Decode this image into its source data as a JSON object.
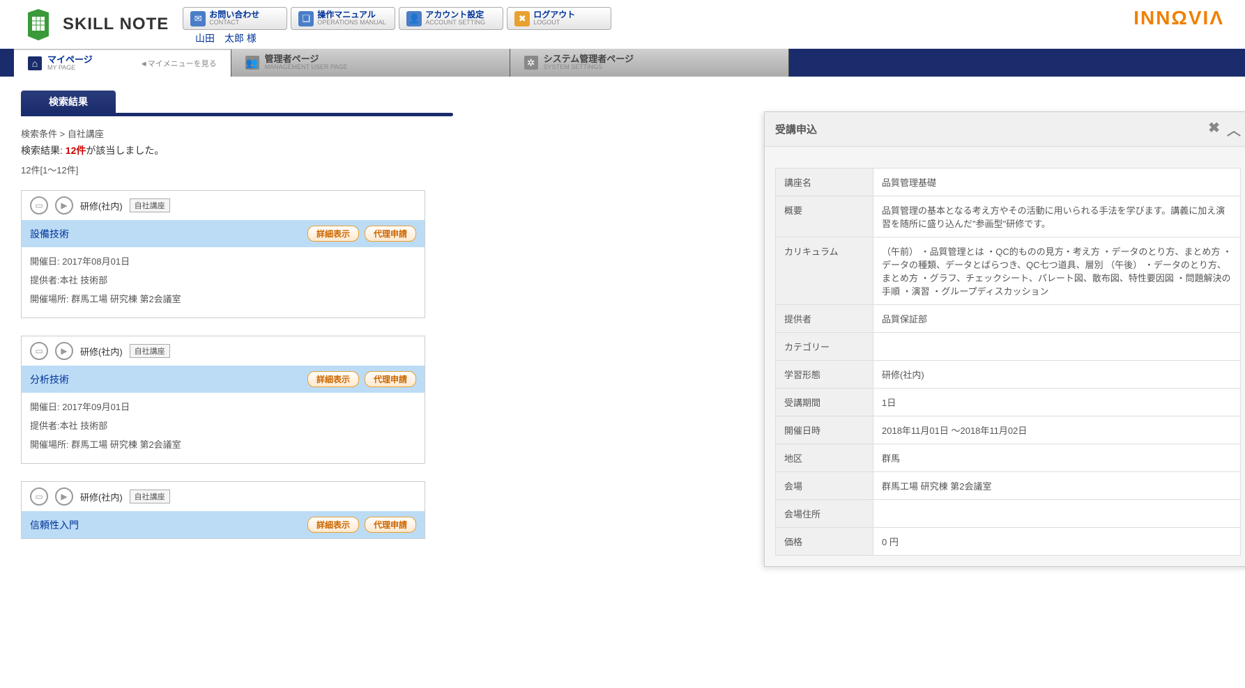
{
  "logo_text": "SKILL NOTE",
  "username": "山田　太郎 様",
  "header_buttons": [
    {
      "jp": "お問い合わせ",
      "en": "CONTACT",
      "icon": "✉",
      "color": "blue"
    },
    {
      "jp": "操作マニュアル",
      "en": "OPERATIONS MANUAL",
      "icon": "❏",
      "color": "blue"
    },
    {
      "jp": "アカウント設定",
      "en": "ACCOUNT SETTING",
      "icon": "👤",
      "color": "blue"
    },
    {
      "jp": "ログアウト",
      "en": "LOGOUT",
      "icon": "✖",
      "color": "orange"
    }
  ],
  "brand_right": "INNΩVIΛ",
  "nav_tabs": [
    {
      "jp": "マイページ",
      "en": "MY PAGE",
      "icon": "⌂",
      "active": true,
      "submenu": "◄マイメニューを見る"
    },
    {
      "jp": "管理者ページ",
      "en": "MANAGEMENT USER PAGE",
      "icon": "👥",
      "active": false
    },
    {
      "jp": "システム管理者ページ",
      "en": "SYSTEM SETTINGS",
      "icon": "✲",
      "active": false
    }
  ],
  "section_title": "検索結果",
  "breadcrumb": "検索条件 > 自社講座",
  "result_prefix": "検索結果: ",
  "result_count": "12件",
  "result_suffix": "が該当しました。",
  "pager_info": "12件[1～12件]",
  "card_labels": {
    "type": "研修(社内)",
    "badge": "自社講座",
    "detail_btn": "詳細表示",
    "proxy_btn": "代理申請",
    "date_label": "開催日: ",
    "provider_label": "提供者:",
    "venue_label": "開催場所: "
  },
  "results": [
    {
      "title": "設備技術",
      "date": "2017年08月01日",
      "provider": "本社  技術部",
      "venue": "群馬工場  研究棟  第2会議室"
    },
    {
      "title": "分析技術",
      "date": "2017年09月01日",
      "provider": "本社  技術部",
      "venue": "群馬工場  研究棟  第2会議室"
    },
    {
      "title": "信頼性入門",
      "date": "",
      "provider": "",
      "venue": ""
    }
  ],
  "panel": {
    "title": "受講申込",
    "fields": [
      {
        "label": "講座名",
        "value": "品質管理基礎"
      },
      {
        "label": "概要",
        "value": "品質管理の基本となる考え方やその活動に用いられる手法を学びます。講義に加え演習を随所に盛り込んだ\"参画型\"研修です。"
      },
      {
        "label": "カリキュラム",
        "value": "（午前） ・品質管理とは ・QC的ものの見方・考え方 ・データのとり方、まとめ方 ・データの種類、データとばらつき、QC七つ道具、層別 （午後） ・データのとり方、まとめ方 ・グラフ、チェックシート、パレート図、散布図、特性要因図 ・問題解決の手順 ・演習 ・グループディスカッション"
      },
      {
        "label": "提供者",
        "value": "品質保証部"
      },
      {
        "label": "カテゴリー",
        "value": ""
      },
      {
        "label": "学習形態",
        "value": "研修(社内)"
      },
      {
        "label": "受講期間",
        "value": "1日"
      },
      {
        "label": "開催日時",
        "value": "2018年11月01日 ～2018年11月02日"
      },
      {
        "label": "地区",
        "value": "群馬"
      },
      {
        "label": "会場",
        "value": "群馬工場  研究棟  第2会議室"
      },
      {
        "label": "会場住所",
        "value": ""
      },
      {
        "label": "価格",
        "value": "0 円"
      }
    ]
  }
}
